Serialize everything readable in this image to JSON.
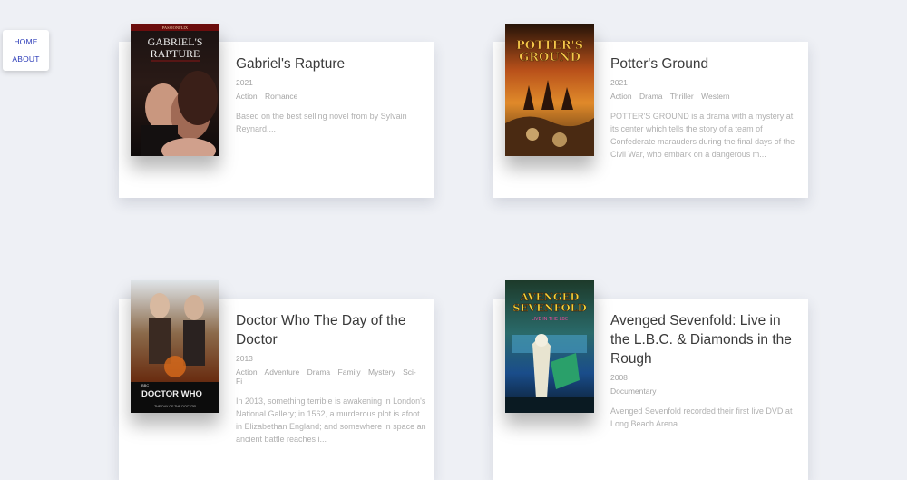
{
  "nav": {
    "home": "HOME",
    "about": "ABOUT"
  },
  "movies": [
    {
      "title": "Gabriel's Rapture",
      "year": "2021",
      "genres": [
        "Action",
        "Romance"
      ],
      "summary": "Based on the best selling novel from by Sylvain Reynard....",
      "poster": {
        "top_text": "PASSIONFLIX",
        "title_lines": [
          "GABRIEL'S",
          "RAPTURE"
        ]
      }
    },
    {
      "title": "Potter's Ground",
      "year": "2021",
      "genres": [
        "Action",
        "Drama",
        "Thriller",
        "Western"
      ],
      "summary": "POTTER'S GROUND is a drama with a mystery at its center which tells the story of a team of Confederate marauders during the final days of the Civil War, who embark on a dangerous m...",
      "poster": {
        "title_lines": [
          "POTTER'S",
          "GROUND"
        ]
      }
    },
    {
      "title": "Doctor Who The Day of the Doctor",
      "year": "2013",
      "genres": [
        "Action",
        "Adventure",
        "Drama",
        "Family",
        "Mystery",
        "Sci-Fi"
      ],
      "summary": "In 2013, something terrible is awakening in London's National Gallery; in 1562, a murderous plot is afoot in Elizabethan England; and somewhere in space an ancient battle reaches i...",
      "poster": {
        "top_text": "BBC",
        "title_lines": [
          "DOCTOR WHO"
        ],
        "sub_text": "THE DAY OF THE DOCTOR"
      }
    },
    {
      "title": "Avenged Sevenfold: Live in the L.B.C. & Diamonds in the Rough",
      "year": "2008",
      "genres": [
        "Documentary"
      ],
      "summary": "Avenged Sevenfold recorded their first live DVD at Long Beach Arena....",
      "poster": {
        "title_lines": [
          "AVENGED",
          "SEVENFOLD"
        ],
        "sub_text": "LIVE IN THE LBC"
      }
    }
  ]
}
